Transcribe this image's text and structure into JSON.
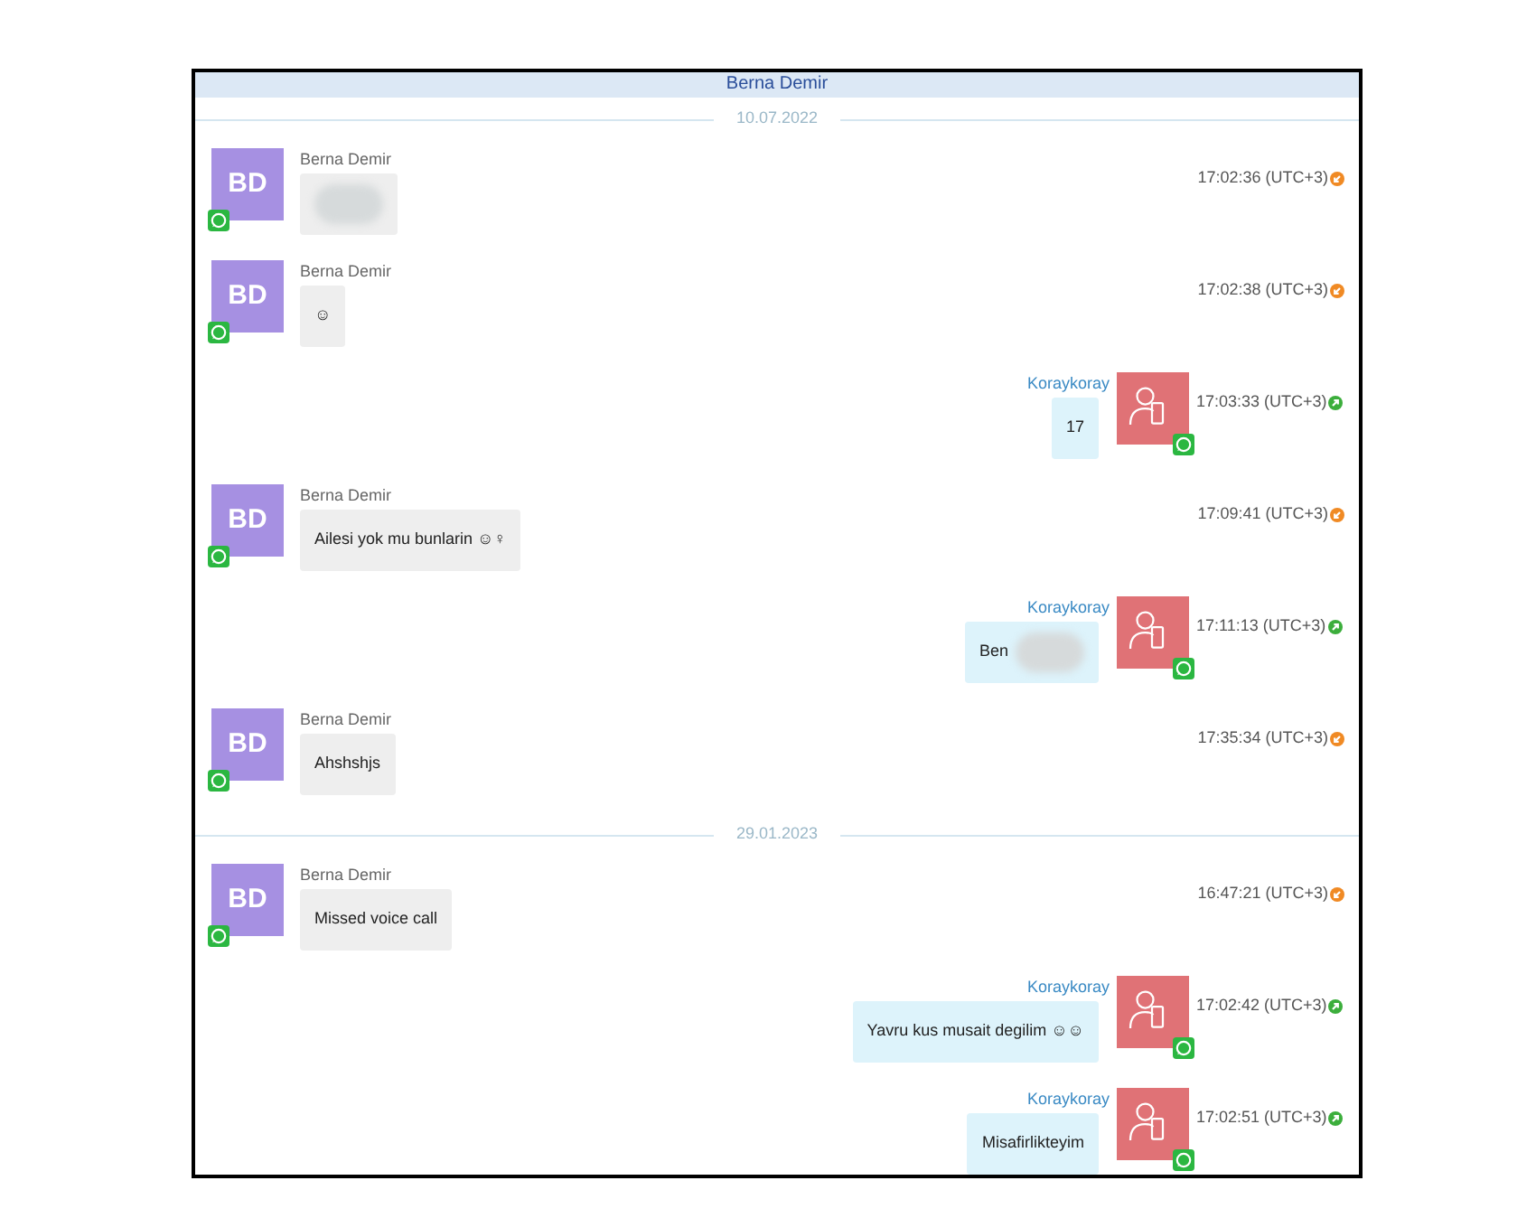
{
  "header": {
    "title": "Berna Demir"
  },
  "items": [
    {
      "kind": "date",
      "text": "10.07.2022"
    },
    {
      "kind": "incoming",
      "sender": "Berna Demir",
      "initials": "BD",
      "redacted": true,
      "time": "17:02:36 (UTC+3)"
    },
    {
      "kind": "incoming",
      "sender": "Berna Demir",
      "initials": "BD",
      "text": "☺",
      "time": "17:02:38 (UTC+3)"
    },
    {
      "kind": "outgoing",
      "sender": "Koraykoray",
      "text": "17",
      "time": "17:03:33 (UTC+3)"
    },
    {
      "kind": "incoming",
      "sender": "Berna Demir",
      "initials": "BD",
      "text": "Ailesi yok mu bunlarin ☺♀",
      "time": "17:09:41 (UTC+3)"
    },
    {
      "kind": "outgoing",
      "sender": "Koraykoray",
      "text": "Ben",
      "redacted": true,
      "time": "17:11:13 (UTC+3)"
    },
    {
      "kind": "incoming",
      "sender": "Berna Demir",
      "initials": "BD",
      "text": "Ahshshjs",
      "time": "17:35:34 (UTC+3)"
    },
    {
      "kind": "date",
      "text": "29.01.2023"
    },
    {
      "kind": "incoming",
      "sender": "Berna Demir",
      "initials": "BD",
      "text": "Missed voice call",
      "time": "16:47:21 (UTC+3)"
    },
    {
      "kind": "outgoing",
      "sender": "Koraykoray",
      "text": "Yavru kus musait degilim ☺☺",
      "time": "17:02:42 (UTC+3)"
    },
    {
      "kind": "outgoing",
      "sender": "Koraykoray",
      "text": "Misafirlikteyim",
      "time": "17:02:51 (UTC+3)"
    }
  ]
}
